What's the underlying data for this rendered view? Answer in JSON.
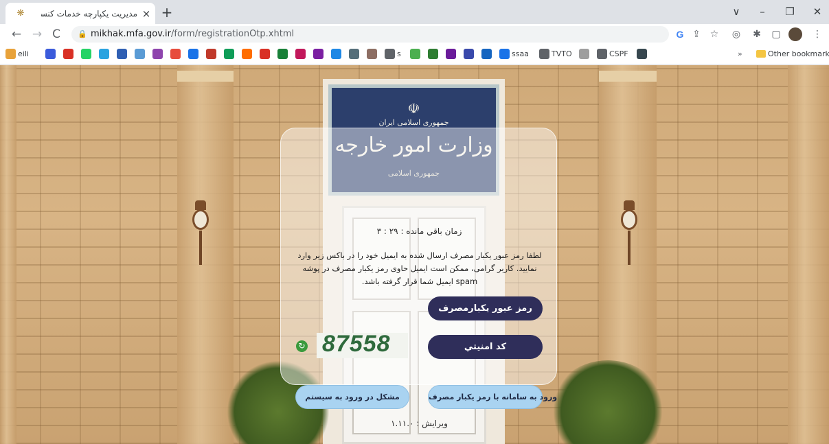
{
  "browser": {
    "tab_title": "مدیریت یکپارچه خدمات کنسولی",
    "tab_close": "×",
    "new_tab": "+",
    "url_host": "mikhak.mfa.gov.ir",
    "url_path": "/form/registrationOtp.xhtml",
    "window_controls": {
      "tabsearch": "∨",
      "minimize": "–",
      "restore": "❐",
      "close": "✕"
    },
    "nav": {
      "back": "←",
      "forward": "→",
      "reload": "C"
    },
    "toolbar_icons": [
      "google-icon",
      "share-icon",
      "star-icon",
      "extension-icon",
      "puzzle-icon",
      "sidepanel-icon",
      "profile-avatar",
      "menu-icon"
    ],
    "toolbar_glyphs": {
      "google": "G",
      "share": "⇪",
      "star": "☆",
      "ext": "◎",
      "puzzle": "✱",
      "sidepanel": "▢",
      "menu": "⋮"
    }
  },
  "bookmarks": {
    "items": [
      {
        "label": "eili",
        "color": "#e8a23a"
      },
      {
        "label": "",
        "color": "#3b5bdb"
      },
      {
        "label": "",
        "color": "#d93025"
      },
      {
        "label": "",
        "color": "#25d366"
      },
      {
        "label": "",
        "color": "#2aa3e0"
      },
      {
        "label": "",
        "color": "#2f5fb3"
      },
      {
        "label": "",
        "color": "#5a9bd5"
      },
      {
        "label": "",
        "color": "#8e44ad"
      },
      {
        "label": "",
        "color": "#e74c3c"
      },
      {
        "label": "",
        "color": "#1a73e8"
      },
      {
        "label": "",
        "color": "#c0392b"
      },
      {
        "label": "",
        "color": "#0f9d58"
      },
      {
        "label": "",
        "color": "#ff6d00"
      },
      {
        "label": "",
        "color": "#d93025"
      },
      {
        "label": "",
        "color": "#188038"
      },
      {
        "label": "",
        "color": "#c2185b"
      },
      {
        "label": "",
        "color": "#7b1fa2"
      },
      {
        "label": "",
        "color": "#1e88e5"
      },
      {
        "label": "",
        "color": "#546e7a"
      },
      {
        "label": "",
        "color": "#8d6e63"
      },
      {
        "label": "s",
        "color": "#5f6368"
      },
      {
        "label": "",
        "color": "#4caf50"
      },
      {
        "label": "",
        "color": "#2e7d32"
      },
      {
        "label": "",
        "color": "#6a1b9a"
      },
      {
        "label": "",
        "color": "#3949ab"
      },
      {
        "label": "",
        "color": "#1565c0"
      },
      {
        "label": "ssaa",
        "color": "#1a73e8"
      },
      {
        "label": "TVTO",
        "color": "#5f6368"
      },
      {
        "label": "",
        "color": "#9e9e9e"
      },
      {
        "label": "CSPF",
        "color": "#5f6368"
      },
      {
        "label": "",
        "color": "#37474f"
      }
    ],
    "overflow": "»",
    "other_bookmarks": "Other bookmarks"
  },
  "plaque": {
    "emblem": "☫",
    "line1": "جمهوری اسلامی ایران",
    "line2": "وزارت امور خارجه",
    "line3": "جمهوری اسلامی"
  },
  "login": {
    "timer": "زمان باقي مانده : ۲۹ : ۳",
    "message": "لطفا رمز عبور یکبار مصرف ارسال شده به ایمیل خود را در باکس زیر وارد نمایید. کاربر گرامی، ممکن است ایمیل حاوی رمز یکبار مصرف در پوشه spam ایمیل شما قرار گرفته باشد.",
    "otp_placeholder": "رمز عبور یکبارمصرف",
    "captcha_placeholder": "کد امنيتي",
    "captcha_code": "87558",
    "refresh_glyph": "↻",
    "login_button": "ورود به سامانه با رمز یکبار مصرف",
    "trouble_button": "مشکل در ورود به سیستم",
    "version": "ویرایش : ۱.۱۱.۰"
  }
}
